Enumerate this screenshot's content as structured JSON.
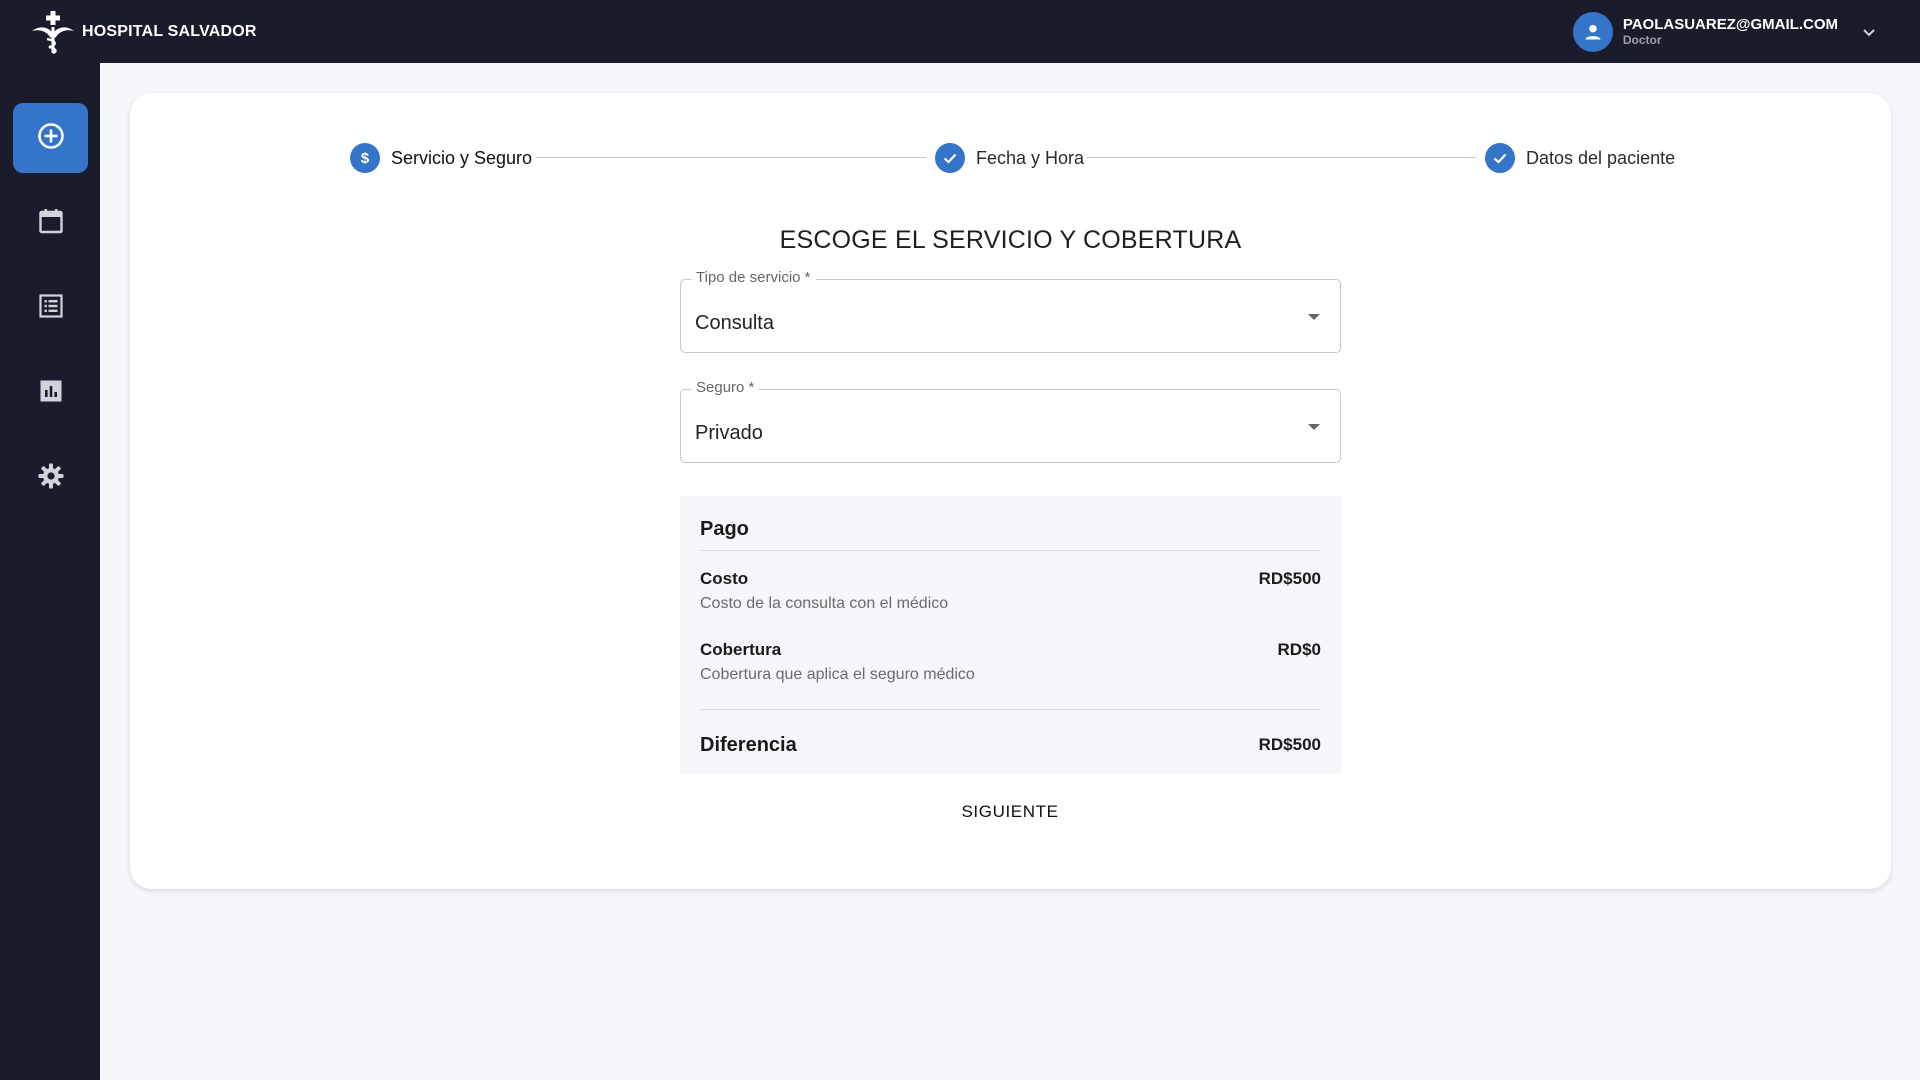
{
  "header": {
    "brand_name": "HOSPITAL SALVADOR",
    "logo_icon": "hospital-caduceus-icon",
    "user": {
      "email": "PAOLASUAREZ@GMAIL.COM",
      "role": "Doctor",
      "avatar_icon": "person-icon",
      "menu_icon": "chevron-down-icon"
    }
  },
  "sidebar": {
    "items": [
      {
        "icon": "add-circle-icon",
        "active": true
      },
      {
        "icon": "calendar-icon",
        "active": false
      },
      {
        "icon": "list-icon",
        "active": false
      },
      {
        "icon": "bar-chart-icon",
        "active": false
      },
      {
        "icon": "gear-icon",
        "active": false
      }
    ]
  },
  "stepper": {
    "steps": [
      {
        "label": "Servicio y Seguro",
        "icon": "dollar-icon",
        "active": true
      },
      {
        "label": "Fecha y Hora",
        "icon": "check-icon",
        "active": false
      },
      {
        "label": "Datos del paciente",
        "icon": "check-icon",
        "active": false
      }
    ]
  },
  "form": {
    "title": "ESCOGE EL SERVICIO Y COBERTURA",
    "service": {
      "label": "Tipo de servicio *",
      "value": "Consulta"
    },
    "insurance": {
      "label": "Seguro *",
      "value": "Privado"
    }
  },
  "payment": {
    "title": "Pago",
    "cost": {
      "label": "Costo",
      "description": "Costo de la consulta con el médico",
      "amount": "RD$500"
    },
    "coverage": {
      "label": "Cobertura",
      "description": "Cobertura que aplica el seguro médico",
      "amount": "RD$0"
    },
    "difference": {
      "label": "Diferencia",
      "amount": "RD$500"
    }
  },
  "actions": {
    "next_label": "SIGUIENTE"
  },
  "colors": {
    "topbar_bg": "#1b1c2b",
    "accent": "#3474c9",
    "page_bg": "#f5f7fb",
    "card_bg": "#ffffff"
  }
}
